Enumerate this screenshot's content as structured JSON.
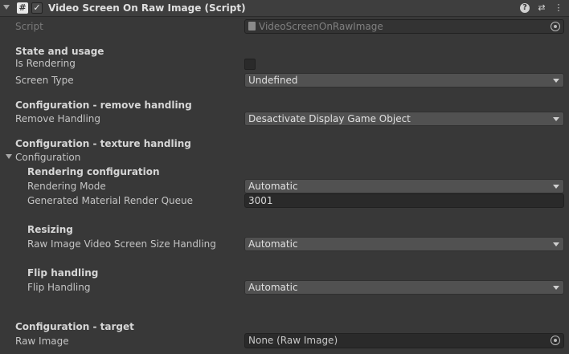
{
  "header": {
    "title": "Video Screen On Raw Image (Script)",
    "script_glyph": "#",
    "enabled_check": "✓",
    "help_glyph": "?",
    "preset_glyph": "⇄",
    "menu_glyph": "⋮"
  },
  "script_row": {
    "label": "Script",
    "value": "VideoScreenOnRawImage"
  },
  "state_section": {
    "title": "State and usage",
    "is_rendering_label": "Is Rendering",
    "is_rendering": false,
    "screen_type_label": "Screen Type",
    "screen_type_value": "Undefined"
  },
  "remove_section": {
    "title": "Configuration - remove handling",
    "remove_handling_label": "Remove Handling",
    "remove_handling_value": "Desactivate Display Game Object"
  },
  "texture_section": {
    "title": "Configuration - texture handling",
    "foldout_label": "Configuration",
    "rendering_title": "Rendering configuration",
    "rendering_mode_label": "Rendering Mode",
    "rendering_mode_value": "Automatic",
    "render_queue_label": "Generated Material Render Queue",
    "render_queue_value": "3001",
    "resizing_title": "Resizing",
    "size_handling_label": "Raw Image Video Screen Size Handling",
    "size_handling_value": "Automatic",
    "flip_title": "Flip handling",
    "flip_handling_label": "Flip Handling",
    "flip_handling_value": "Automatic"
  },
  "target_section": {
    "title": "Configuration - target",
    "raw_image_label": "Raw Image",
    "raw_image_value": "None (Raw Image)"
  }
}
